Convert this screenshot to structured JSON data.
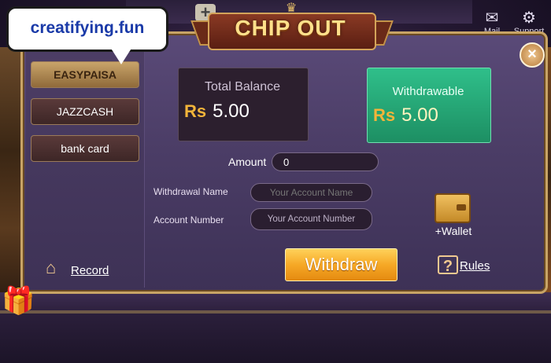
{
  "watermark": {
    "text": "creatifying.fun"
  },
  "header": {
    "title": "CHIP OUT",
    "mail_label": "Mail",
    "support_label": "Support",
    "plus_label": "+"
  },
  "sidebar": {
    "items": [
      {
        "label": "EASYPAISA",
        "active": true
      },
      {
        "label": "JAZZCASH",
        "active": false
      },
      {
        "label": "bank card",
        "active": false
      }
    ]
  },
  "balances": {
    "total_label": "Total Balance",
    "currency": "Rs",
    "total_value": "5.00",
    "withdrawable_label": "Withdrawable",
    "withdrawable_value": "5.00"
  },
  "form": {
    "amount_label": "Amount",
    "amount_value": "0",
    "withdrawal_name_label": "Withdrawal Name",
    "withdrawal_name_placeholder": "Your Account Name",
    "account_number_label": "Account Number",
    "account_number_placeholder": "Your Account Number"
  },
  "actions": {
    "wallet_label": "+Wallet",
    "record_label": "Record",
    "withdraw_label": "Withdraw",
    "rules_label": "Rules"
  },
  "icons": {
    "close": "close-icon",
    "mail": "mail-icon",
    "support": "gear-icon",
    "wallet": "wallet-icon",
    "record": "house-icon",
    "rules": "question-icon",
    "gift": "gift-icon"
  },
  "colors": {
    "accent_gold": "#f2b43a",
    "withdrawable_green": "#2fbf8a",
    "withdraw_button": "#f6a826",
    "panel_purple": "#4b3d66"
  }
}
